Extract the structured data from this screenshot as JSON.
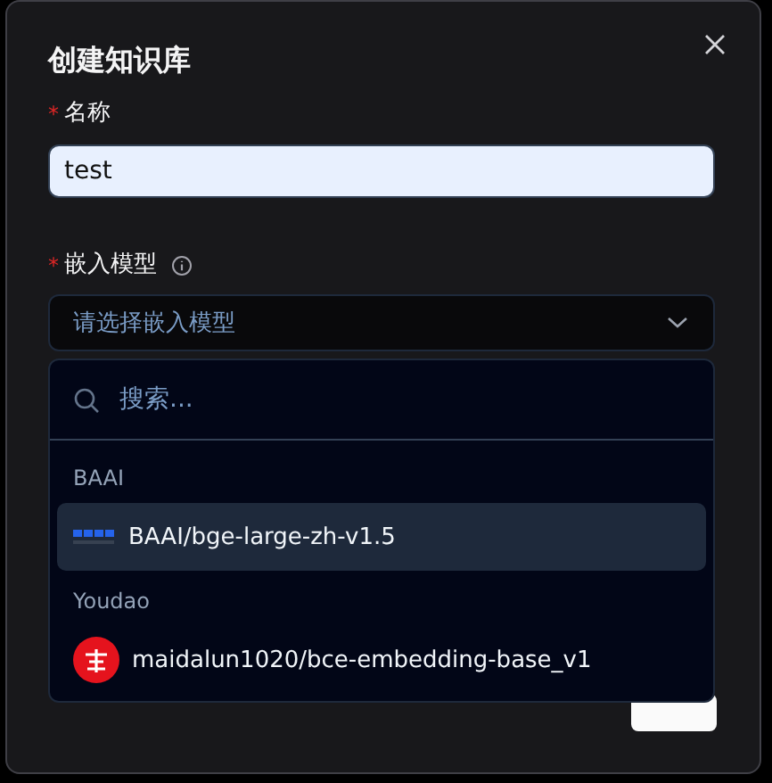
{
  "dialog": {
    "title": "创建知识库"
  },
  "fields": [
    {
      "label": "名称",
      "required_mark": "*",
      "value": "test"
    },
    {
      "label": "嵌入模型",
      "required_mark": "*",
      "info": true,
      "placeholder": "请选择嵌入模型",
      "expanded": true
    }
  ],
  "dropdown": {
    "search_placeholder": "搜索...",
    "groups": [
      {
        "name": "BAAI",
        "items": [
          {
            "label": "BAAI/bge-large-zh-v1.5",
            "kind": "bars",
            "selected": true
          }
        ]
      },
      {
        "name": "Youdao",
        "items": [
          {
            "label": "maidalun1020/bce-embedding-base_v1",
            "kind": "round",
            "selected": false
          }
        ]
      }
    ]
  }
}
